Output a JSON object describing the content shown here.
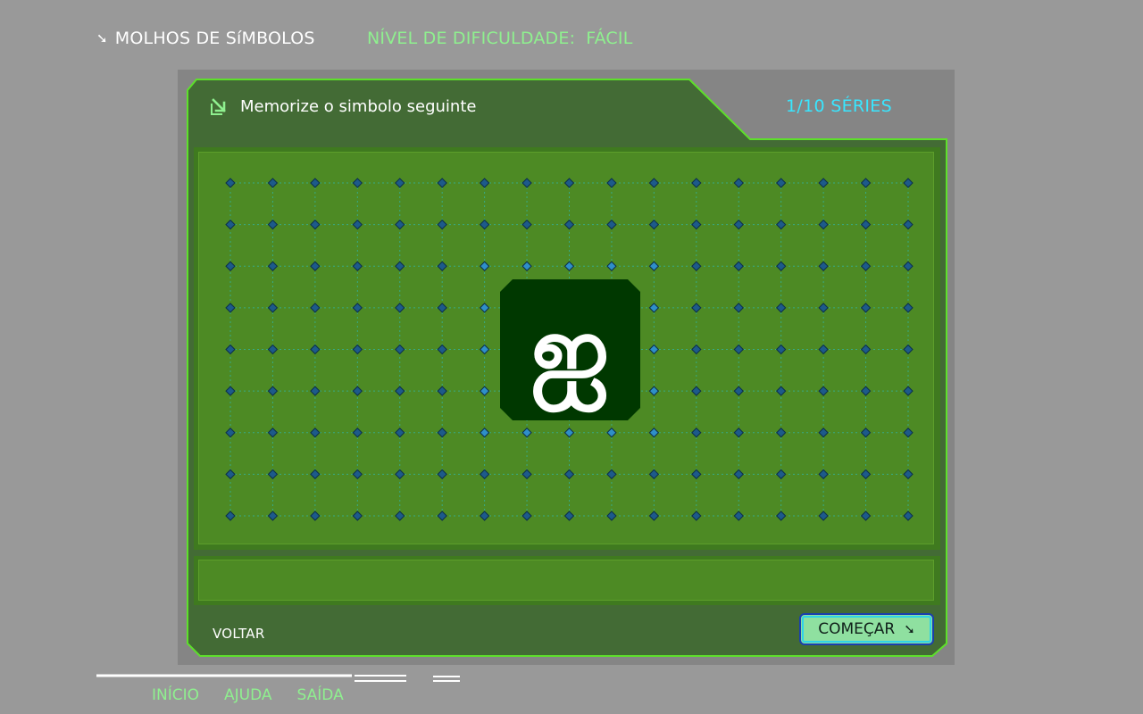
{
  "header": {
    "game_title": "MOLHOS DE SíMBOLOS",
    "title_icon": "arrow-down-right-icon",
    "difficulty_label": "NÍVEL DE DIFICULDADE:",
    "difficulty_value": "FÁCIL"
  },
  "panel": {
    "prompt": "Memorize o simbolo seguinte",
    "prompt_icon": "arrow-down-right-icon",
    "series_counter": "1/10 SÉRIES"
  },
  "board": {
    "columns": 17,
    "rows": 9,
    "symbol": "ஐ",
    "symbol_tile_color": "#003800",
    "dot_color": "#1d5a8a",
    "highlight_dot_color": "#2f8fc8"
  },
  "actions": {
    "back_label": "VOLTAR",
    "start_label": "COMEÇAR",
    "start_icon": "arrow-down-right-icon"
  },
  "footer": {
    "nav": [
      "INÍCIO",
      "AJUDA",
      "SAÍDA"
    ]
  },
  "colors": {
    "background": "#999999",
    "panel_dark": "#436b35",
    "board_green": "#4d8a24",
    "accent_green": "#8ff08f",
    "accent_cyan": "#39e6ff",
    "frame_border": "#5de02a"
  }
}
